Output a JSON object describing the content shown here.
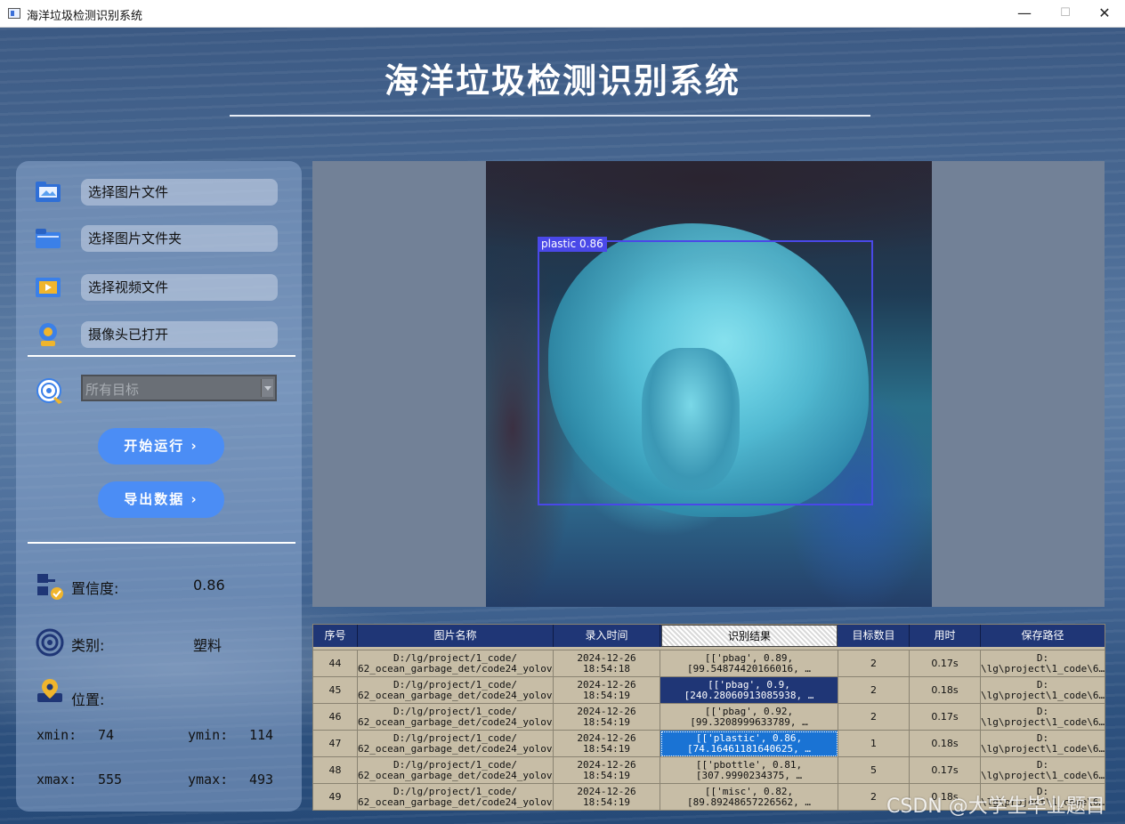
{
  "window": {
    "title": "海洋垃圾检测识别系统",
    "min": "—",
    "max": "☐",
    "close": "✕"
  },
  "header": {
    "title": "海洋垃圾检测识别系统"
  },
  "left_panel": {
    "buttons": [
      {
        "label": "选择图片文件",
        "icon": "image-folder-icon"
      },
      {
        "label": "选择图片文件夹",
        "icon": "folder-icon"
      },
      {
        "label": "选择视频文件",
        "icon": "video-icon"
      },
      {
        "label": "摄像头已打开",
        "icon": "camera-icon"
      }
    ],
    "target_select": {
      "value": "所有目标",
      "icon": "target-icon"
    },
    "run_button": "开始运行 ›",
    "export_button": "导出数据 ›",
    "confidence": {
      "label": "置信度:",
      "value": "0.86"
    },
    "category": {
      "label": "类别:",
      "value": "塑料"
    },
    "position": {
      "label": "位置:"
    },
    "coords": {
      "xmin_label": "xmin:",
      "xmin": "74",
      "ymin_label": "ymin:",
      "ymin": "114",
      "xmax_label": "xmax:",
      "xmax": "555",
      "ymax_label": "ymax:",
      "ymax": "493"
    }
  },
  "detection": {
    "label": "plastic 0.86",
    "box_color": "#4a48e8"
  },
  "table": {
    "headers": [
      "序号",
      "图片名称",
      "录入时间",
      "识别结果",
      "目标数目",
      "用时",
      "保存路径"
    ],
    "rows": [
      {
        "id": "44",
        "name1": "D:/lg/project/1_code/",
        "name2": "62_ocean_garbage_det/code24_yolov…",
        "t1": "2024-12-26",
        "t2": "18:54:18",
        "r1": "[['pbag', 0.89,",
        "r2": "[99.54874420166016, …",
        "count": "2",
        "time": "0.17s",
        "p1": "D:",
        "p2": "\\lg\\project\\1_code\\6…"
      },
      {
        "id": "45",
        "name1": "D:/lg/project/1_code/",
        "name2": "62_ocean_garbage_det/code24_yolov…",
        "t1": "2024-12-26",
        "t2": "18:54:19",
        "r1": "[['pbag', 0.9,",
        "r2": "[240.28060913085938, …",
        "count": "2",
        "time": "0.18s",
        "p1": "D:",
        "p2": "\\lg\\project\\1_code\\6…"
      },
      {
        "id": "46",
        "name1": "D:/lg/project/1_code/",
        "name2": "62_ocean_garbage_det/code24_yolov…",
        "t1": "2024-12-26",
        "t2": "18:54:19",
        "r1": "[['pbag', 0.92,",
        "r2": "[99.3208999633789, …",
        "count": "2",
        "time": "0.17s",
        "p1": "D:",
        "p2": "\\lg\\project\\1_code\\6…"
      },
      {
        "id": "47",
        "name1": "D:/lg/project/1_code/",
        "name2": "62_ocean_garbage_det/code24_yolov…",
        "t1": "2024-12-26",
        "t2": "18:54:19",
        "r1": "[['plastic', 0.86,",
        "r2": "[74.16461181640625, …",
        "count": "1",
        "time": "0.18s",
        "p1": "D:",
        "p2": "\\lg\\project\\1_code\\6…"
      },
      {
        "id": "48",
        "name1": "D:/lg/project/1_code/",
        "name2": "62_ocean_garbage_det/code24_yolov…",
        "t1": "2024-12-26",
        "t2": "18:54:19",
        "r1": "[['pbottle', 0.81,",
        "r2": "[307.9990234375, …",
        "count": "5",
        "time": "0.17s",
        "p1": "D:",
        "p2": "\\lg\\project\\1_code\\6…"
      },
      {
        "id": "49",
        "name1": "D:/lg/project/1_code/",
        "name2": "62_ocean_garbage_det/code24_yolov…",
        "t1": "2024-12-26",
        "t2": "18:54:19",
        "r1": "[['misc', 0.82,",
        "r2": "[89.89248657226562, …",
        "count": "2",
        "time": "0.18s",
        "p1": "D:",
        "p2": "\\lg\\project\\1_code\\6…"
      }
    ]
  },
  "watermark": "CSDN @大学生毕业题目"
}
